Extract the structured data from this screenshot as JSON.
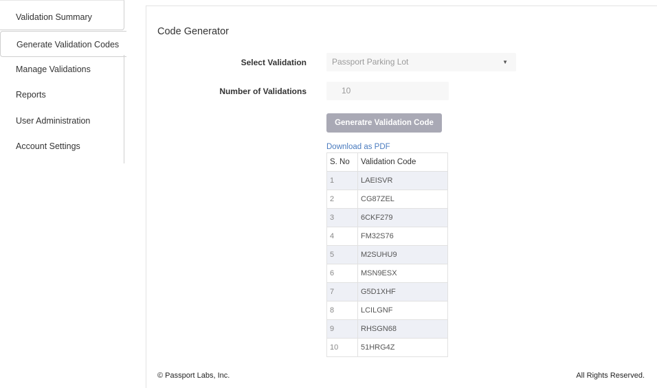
{
  "sidebar": {
    "items": [
      {
        "label": "Validation Summary"
      },
      {
        "label": "Generate Validation Codes"
      },
      {
        "label": "Manage Validations"
      },
      {
        "label": "Reports"
      },
      {
        "label": "User Administration"
      },
      {
        "label": "Account Settings"
      }
    ]
  },
  "main": {
    "title": "Code Generator",
    "select_label": "Select Validation",
    "select_value": "Passport Parking Lot",
    "count_label": "Number of Validations",
    "count_value": "10",
    "generate_button": "Generatre Validation Code",
    "download_link": "Download as PDF",
    "table": {
      "headers": [
        "S. No",
        "Validation Code"
      ],
      "rows": [
        [
          "1",
          "LAEISVR"
        ],
        [
          "2",
          "CG87ZEL"
        ],
        [
          "3",
          "6CKF279"
        ],
        [
          "4",
          "FM32S76"
        ],
        [
          "5",
          "M2SUHU9"
        ],
        [
          "6",
          "MSN9ESX"
        ],
        [
          "7",
          "G5D1XHF"
        ],
        [
          "8",
          "LCILGNF"
        ],
        [
          "9",
          "RHSGN68"
        ],
        [
          "10",
          "51HRG4Z"
        ]
      ]
    }
  },
  "footer": {
    "copyright": "© Passport Labs, Inc.",
    "rights": "All Rights Reserved."
  },
  "colors": {
    "button_bg": "#a9a9b5",
    "link": "#4a7bbf",
    "row_alt": "#eef0f6"
  }
}
